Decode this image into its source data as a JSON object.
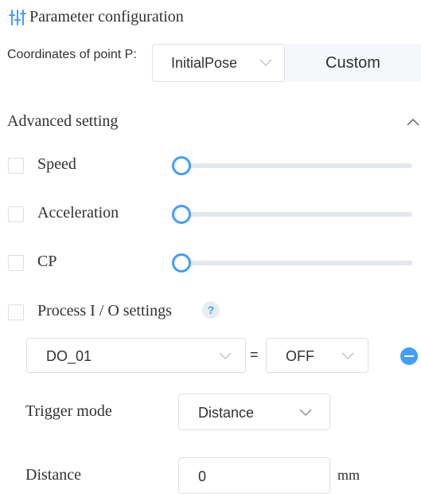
{
  "header": {
    "title": "Parameter configuration",
    "icon": "sliders-icon"
  },
  "point": {
    "label": "Coordinates of point P:",
    "selected": "InitialPose",
    "custom_label": "Custom"
  },
  "advanced": {
    "label": "Advanced setting",
    "expanded": true,
    "sliders": [
      {
        "label": "Speed",
        "checked": false,
        "value": 0
      },
      {
        "label": "Acceleration",
        "checked": false,
        "value": 0
      },
      {
        "label": "CP",
        "checked": false,
        "value": 0
      }
    ]
  },
  "process_io": {
    "label": "Process I / O settings",
    "checked": false,
    "help": "?",
    "output": "DO_01",
    "equals": "=",
    "state": "OFF",
    "trigger_label": "Trigger mode",
    "trigger_value": "Distance",
    "distance_label": "Distance",
    "distance_value": "0",
    "distance_unit": "mm"
  },
  "colors": {
    "accent": "#409eff",
    "border": "#dcdfe6",
    "track": "#e4e7ed",
    "text": "#303133"
  }
}
